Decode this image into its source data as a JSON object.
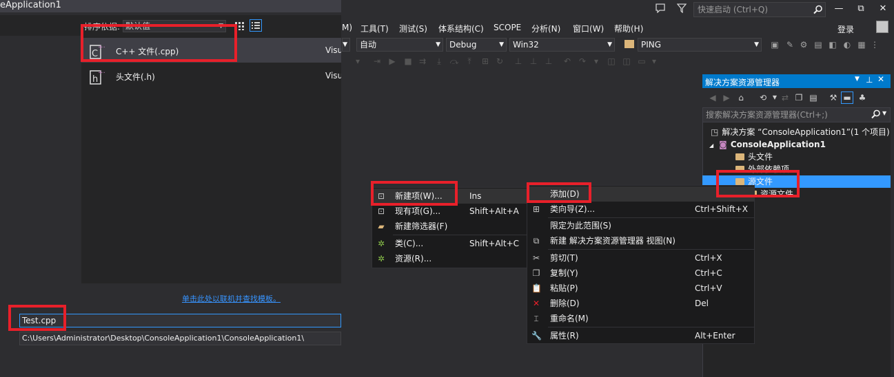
{
  "dialog": {
    "title": "eApplication1",
    "sort_label": "排序依据:",
    "sort_value": "默认值",
    "templates": [
      {
        "name": "C++ 文件(.cpp)",
        "lang": "Visu"
      },
      {
        "name": "头文件(.h)",
        "lang": "Visu"
      }
    ],
    "online_link": "单击此处以联机并查找模板。",
    "file_name": "Test.cpp",
    "location": "C:\\Users\\Administrator\\Desktop\\ConsoleApplication1\\ConsoleApplication1\\"
  },
  "ide": {
    "quick_launch_placeholder": "快速启动 (Ctrl+Q)",
    "window_buttons": [
      "—",
      "⧉",
      "✕"
    ],
    "menu": [
      {
        "label": "M)"
      },
      {
        "label": "工具(T)"
      },
      {
        "label": "测试(S)"
      },
      {
        "label": "体系结构(C)"
      },
      {
        "label": "SCOPE"
      },
      {
        "label": "分析(N)"
      },
      {
        "label": "窗口(W)"
      },
      {
        "label": "帮助(H)"
      }
    ],
    "login": "登录",
    "toolbar": {
      "config_auto": "自动",
      "config": "Debug",
      "platform": "Win32",
      "project": "PING"
    }
  },
  "solution_explorer": {
    "title": "解决方案资源管理器",
    "search_placeholder": "搜索解决方案资源管理器(Ctrl+;)",
    "tree": [
      {
        "label": "解决方案 “ConsoleApplication1”(1 个项目)"
      },
      {
        "label": "ConsoleApplication1"
      },
      {
        "label": "头文件"
      },
      {
        "label": "外部依赖项"
      },
      {
        "label": "源文件"
      },
      {
        "label": "资源文件"
      }
    ]
  },
  "context_menu": {
    "items": [
      {
        "label": "添加(D)",
        "shortcut": ""
      },
      {
        "label": "类向导(Z)...",
        "shortcut": "Ctrl+Shift+X"
      },
      {
        "label": "限定为此范围(S)",
        "shortcut": ""
      },
      {
        "label": "新建 解决方案资源管理器 视图(N)",
        "shortcut": ""
      },
      {
        "label": "剪切(T)",
        "shortcut": "Ctrl+X"
      },
      {
        "label": "复制(Y)",
        "shortcut": "Ctrl+C"
      },
      {
        "label": "粘贴(P)",
        "shortcut": "Ctrl+V"
      },
      {
        "label": "删除(D)",
        "shortcut": "Del"
      },
      {
        "label": "重命名(M)",
        "shortcut": ""
      },
      {
        "label": "属性(R)",
        "shortcut": "Alt+Enter"
      }
    ]
  },
  "add_submenu": {
    "items": [
      {
        "label": "新建项(W)...",
        "shortcut": "Ins"
      },
      {
        "label": "现有项(G)...",
        "shortcut": "Shift+Alt+A"
      },
      {
        "label": "新建筛选器(F)",
        "shortcut": ""
      },
      {
        "label": "类(C)...",
        "shortcut": "Shift+Alt+C"
      },
      {
        "label": "资源(R)...",
        "shortcut": ""
      }
    ]
  },
  "colors": {
    "annotation": "#e8202a",
    "accent": "#007acc",
    "selection": "#3399ff"
  }
}
